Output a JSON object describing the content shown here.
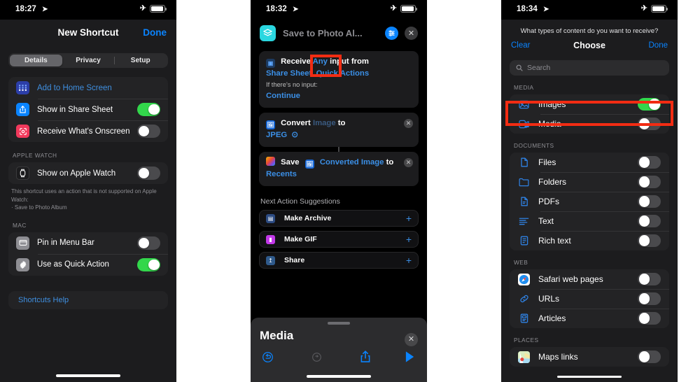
{
  "panel1": {
    "status": {
      "time": "18:27",
      "location_icon": "location-arrow-icon",
      "airplane_icon": "airplane-icon",
      "battery_icon": "battery-icon"
    },
    "nav": {
      "title": "New Shortcut",
      "done": "Done"
    },
    "segments": [
      {
        "label": "Details",
        "active": true
      },
      {
        "label": "Privacy",
        "active": false
      },
      {
        "label": "Setup",
        "active": false
      }
    ],
    "group1": [
      {
        "label": "Add to Home Screen",
        "icon": "home-screen-grid-icon",
        "icon_color": "#2c3ea8",
        "style": "link"
      },
      {
        "label": "Show in Share Sheet",
        "icon": "share-icon",
        "icon_color": "#0a84ff",
        "toggle": "on"
      },
      {
        "label": "Receive What's Onscreen",
        "icon": "onscreen-scan-icon",
        "icon_color": "#f1395c",
        "toggle": "off"
      }
    ],
    "section_watch": "APPLE WATCH",
    "group2": [
      {
        "label": "Show on Apple Watch",
        "icon": "apple-watch-icon",
        "icon_color": "#1c1c1e",
        "toggle": "off"
      }
    ],
    "footnote": "This shortcut uses an action that is not supported on Apple Watch:\n· Save to Photo Album",
    "section_mac": "MAC",
    "group3": [
      {
        "label": "Pin in Menu Bar",
        "icon": "menu-bar-icon",
        "icon_color": "#8e8e93",
        "toggle": "off"
      },
      {
        "label": "Use as Quick Action",
        "icon": "gear-icon",
        "icon_color": "#8e8e93",
        "toggle": "on"
      }
    ],
    "help": "Shortcuts Help"
  },
  "panel2": {
    "status": {
      "time": "18:32"
    },
    "header": {
      "title": "Save to Photo Al...",
      "app_icon": "shortcuts-layers-icon",
      "settings_icon": "sliders-icon",
      "close_icon": "close-icon"
    },
    "action1": {
      "prefix": "Receive",
      "type": "Any",
      "mid": "input from",
      "sources": "Share Sheet, Quick Actions",
      "no_input_label": "If there's no input:",
      "no_input_value": "Continue",
      "icon": "receive-input-icon"
    },
    "action2": {
      "verb": "Convert",
      "variable": "Image",
      "to": "to",
      "format": "JPEG",
      "chevron": "chevron-right-icon",
      "icon": "image-icon"
    },
    "action3": {
      "verb": "Save",
      "variable": "Converted Image",
      "to": "to",
      "album": "Recents",
      "icon": "photos-icon",
      "var_icon": "image-icon"
    },
    "suggestions_title": "Next Action Suggestions",
    "suggestions": [
      {
        "label": "Make Archive",
        "icon": "archive-icon",
        "icon_color": "#2c4b82",
        "add": "+"
      },
      {
        "label": "Make GIF",
        "icon": "gif-icon",
        "icon_color": "#c238e8",
        "add": "+"
      },
      {
        "label": "Share",
        "icon": "share-icon",
        "icon_color": "#2f5a8c",
        "add": "+"
      }
    ],
    "sheet": {
      "title": "Media",
      "close": "close-icon",
      "toolbar": [
        "undo-icon",
        "redo-icon",
        "share-icon",
        "play-icon"
      ]
    }
  },
  "panel3": {
    "status": {
      "time": "18:34"
    },
    "question": "What types of content do you want to receive?",
    "nav": {
      "clear": "Clear",
      "title": "Choose",
      "done": "Done"
    },
    "search_placeholder": "Search",
    "sections": [
      {
        "label": "MEDIA",
        "rows": [
          {
            "label": "Images",
            "icon": "image-icon",
            "toggle": "on",
            "highlighted": true
          },
          {
            "label": "Media",
            "icon": "media-music-icon",
            "toggle": "off"
          }
        ]
      },
      {
        "label": "DOCUMENTS",
        "rows": [
          {
            "label": "Files",
            "icon": "file-icon",
            "toggle": "off"
          },
          {
            "label": "Folders",
            "icon": "folder-icon",
            "toggle": "off"
          },
          {
            "label": "PDFs",
            "icon": "pdf-icon",
            "toggle": "off"
          },
          {
            "label": "Text",
            "icon": "text-lines-icon",
            "toggle": "off"
          },
          {
            "label": "Rich text",
            "icon": "rich-text-icon",
            "toggle": "off"
          }
        ]
      },
      {
        "label": "WEB",
        "rows": [
          {
            "label": "Safari web pages",
            "icon": "safari-icon",
            "toggle": "off"
          },
          {
            "label": "URLs",
            "icon": "link-icon",
            "toggle": "off"
          },
          {
            "label": "Articles",
            "icon": "article-icon",
            "toggle": "off"
          }
        ]
      },
      {
        "label": "PLACES",
        "rows": [
          {
            "label": "Maps links",
            "icon": "maps-icon",
            "toggle": "off"
          }
        ]
      }
    ]
  },
  "colors": {
    "accent_blue": "#0a84ff",
    "toggle_on": "#32d74b",
    "highlight_red": "#f22c13",
    "panel_bg": "#1c1c1e",
    "group_bg": "#232325"
  }
}
